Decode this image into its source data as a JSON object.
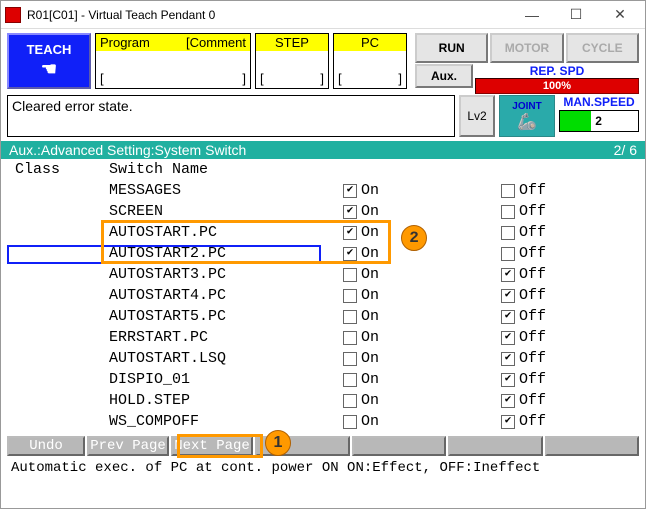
{
  "window": {
    "title": "R01[C01] - Virtual Teach Pendant 0"
  },
  "top": {
    "teach": "TEACH",
    "program_hdr": "Program",
    "comment_hdr": "[Comment",
    "step_hdr": "STEP",
    "pc_hdr": "PC",
    "lbra": "[",
    "rbra": "]",
    "run": "RUN",
    "motor": "MOTOR",
    "cycle": "CYCLE",
    "aux": "Aux.",
    "repspd_label": "REP. SPD",
    "repspd_val": "100%",
    "manspd_label": "MAN.SPEED",
    "manspd_num": "2"
  },
  "mid": {
    "msg": "Cleared error state.",
    "lv2": "Lv2",
    "joint": "JOINT"
  },
  "aux": {
    "title": "Aux.:Advanced Setting:System Switch",
    "pager": "2/ 6"
  },
  "list": {
    "col_class": "Class",
    "col_switch": "Switch Name",
    "on": "On",
    "off": "Off",
    "rows": [
      {
        "name": "MESSAGES",
        "on": true,
        "off": false
      },
      {
        "name": "SCREEN",
        "on": true,
        "off": false
      },
      {
        "name": "AUTOSTART.PC",
        "on": true,
        "off": false
      },
      {
        "name": "AUTOSTART2.PC",
        "on": true,
        "off": false
      },
      {
        "name": "AUTOSTART3.PC",
        "on": false,
        "off": true
      },
      {
        "name": "AUTOSTART4.PC",
        "on": false,
        "off": true
      },
      {
        "name": "AUTOSTART5.PC",
        "on": false,
        "off": true
      },
      {
        "name": "ERRSTART.PC",
        "on": false,
        "off": true
      },
      {
        "name": "AUTOSTART.LSQ",
        "on": false,
        "off": true
      },
      {
        "name": "DISPIO_01",
        "on": false,
        "off": true
      },
      {
        "name": "HOLD.STEP",
        "on": false,
        "off": true
      },
      {
        "name": "WS_COMPOFF",
        "on": false,
        "off": true
      }
    ]
  },
  "buttons": {
    "undo": "Undo",
    "prev": "Prev Page",
    "next": "Next Page"
  },
  "status": "Automatic exec. of PC at cont. power ON   ON:Effect, OFF:Ineffect",
  "annot": {
    "one": "1",
    "two": "2"
  }
}
